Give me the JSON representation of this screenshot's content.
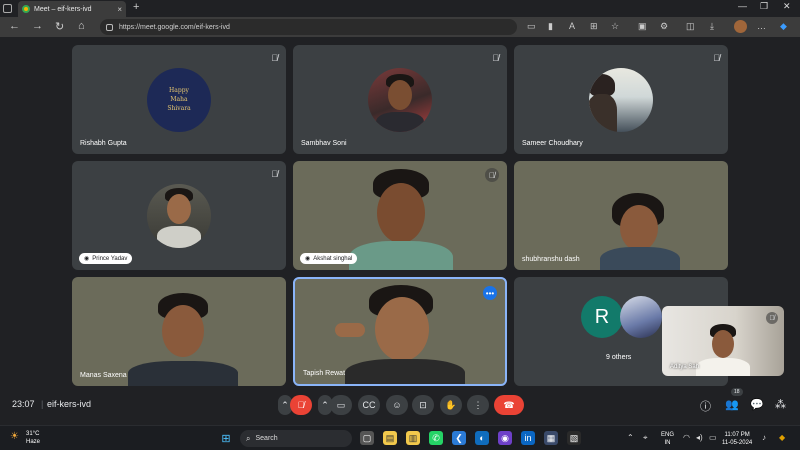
{
  "browser": {
    "tab_title": "Meet – eif-kers-ivd",
    "tab_close": "×",
    "new_tab": "+",
    "url": "https://meet.google.com/eif-kers-ivd",
    "icons": [
      "back-icon",
      "forward-icon",
      "refresh-icon",
      "home-icon",
      "camera-icon",
      "mute-tab-icon",
      "read-aloud-icon",
      "translate-icon",
      "favorite-icon",
      "split-screen-icon",
      "favorites-icon",
      "download-icon",
      "profile-avatar",
      "more-icon",
      "copilot-icon"
    ]
  },
  "meet": {
    "tiles": [
      {
        "name": "Rishabh Gupta",
        "avatar_text_1": "Happy",
        "avatar_text_2": "Maha",
        "avatar_text_3": "Shivara",
        "muted": true
      },
      {
        "name": "Sambhav Soni",
        "muted": true
      },
      {
        "name": "Sameer Choudhary",
        "muted": true
      },
      {
        "name": "Prince Yadav",
        "muted": true
      },
      {
        "name": "Akshat singhal",
        "muted": true
      },
      {
        "name": "shubhranshu dash",
        "muted": false
      },
      {
        "name": "Manas Saxena",
        "muted": false
      },
      {
        "name": "Tapish Rewat",
        "muted": false,
        "more_label": "•••"
      },
      {
        "others_initial": "R",
        "others_label": "9 others"
      }
    ],
    "self_view": {
      "name": "Aditya Sah",
      "muted": true
    },
    "clock": "23:07",
    "separator": "|",
    "meeting_code": "eif-kers-ivd",
    "participants_count": "18"
  },
  "taskbar": {
    "temperature": "31°C",
    "condition": "Haze",
    "search_placeholder": "Search",
    "lang_top": "ENG",
    "lang_bottom": "IN",
    "time": "11:07 PM",
    "date": "11-05-2024"
  }
}
